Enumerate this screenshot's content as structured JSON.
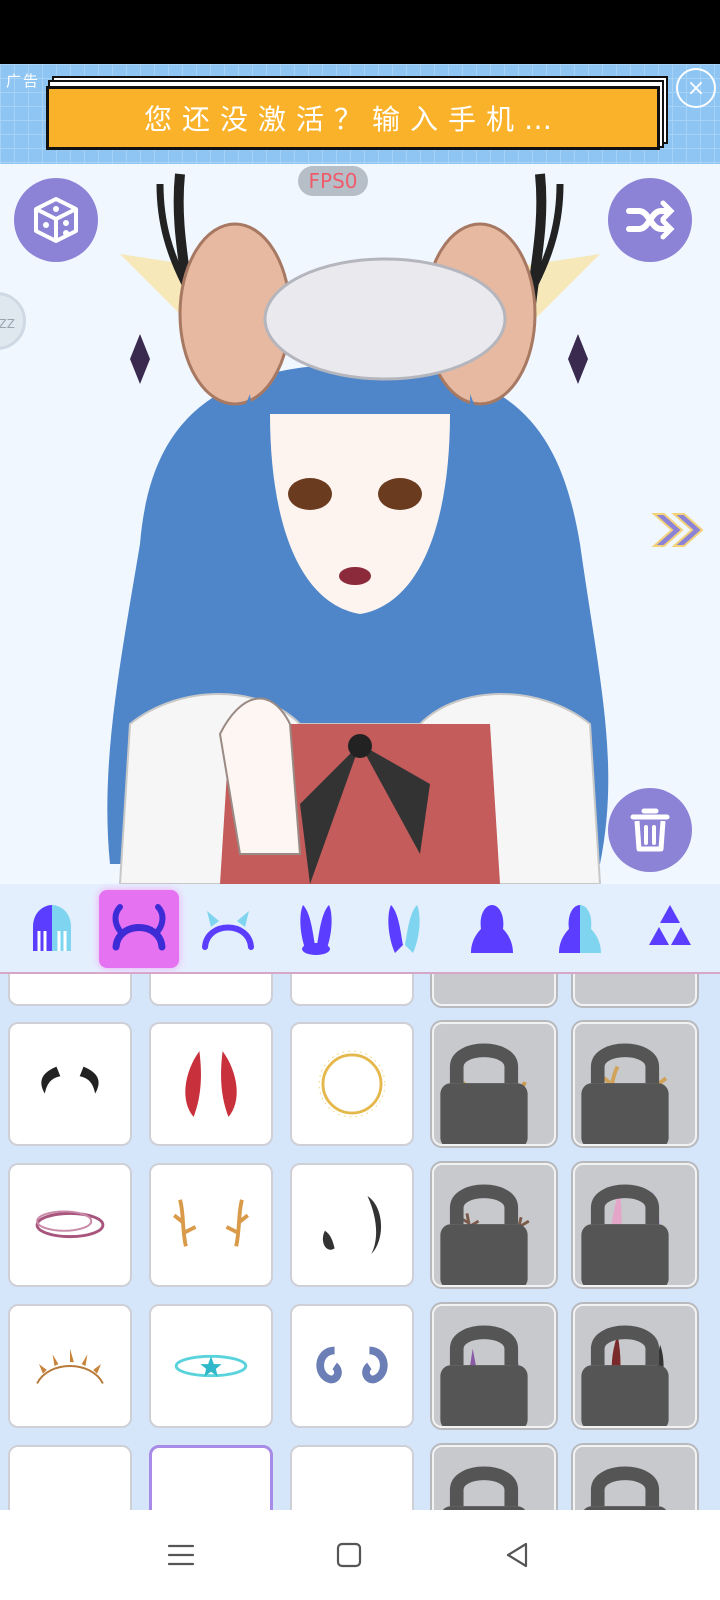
{
  "ad": {
    "tag": "广告",
    "message": "您还没激活？输入手机…",
    "close": "×"
  },
  "stage": {
    "fps": "FPS0",
    "side_badge": "ZZ",
    "buttons": [
      "dice-icon",
      "shuffle-icon",
      "trash-icon",
      "double-chevron-right-icon"
    ]
  },
  "categories": [
    {
      "name": "hair-icon",
      "selected": false
    },
    {
      "name": "horns-headband-icon",
      "selected": true
    },
    {
      "name": "headband-icon",
      "selected": false
    },
    {
      "name": "bunny-ears-icon",
      "selected": false
    },
    {
      "name": "bunny-ears-alt-icon",
      "selected": false
    },
    {
      "name": "hood-icon",
      "selected": false
    },
    {
      "name": "split-hood-icon",
      "selected": false
    },
    {
      "name": "triforce-icon",
      "selected": false
    }
  ],
  "items": [
    {
      "name": "black-curved-horns",
      "locked": false
    },
    {
      "name": "red-horns",
      "locked": false
    },
    {
      "name": "golden-halo",
      "locked": false
    },
    {
      "name": "golden-branch-horns",
      "locked": true
    },
    {
      "name": "golden-antlers",
      "locked": true
    },
    {
      "name": "pink-ring-halo",
      "locked": false
    },
    {
      "name": "deer-antlers",
      "locked": false
    },
    {
      "name": "black-demon-horns",
      "locked": false
    },
    {
      "name": "brown-antlers",
      "locked": true
    },
    {
      "name": "pastel-unicorn-horns",
      "locked": true
    },
    {
      "name": "spiked-crown",
      "locked": false
    },
    {
      "name": "cyan-star-halo",
      "locked": false
    },
    {
      "name": "ram-horns",
      "locked": false
    },
    {
      "name": "purple-spikes",
      "locked": true
    },
    {
      "name": "red-bow-horns",
      "locked": true
    }
  ],
  "nav": [
    "menu-icon",
    "home-icon",
    "back-icon"
  ]
}
